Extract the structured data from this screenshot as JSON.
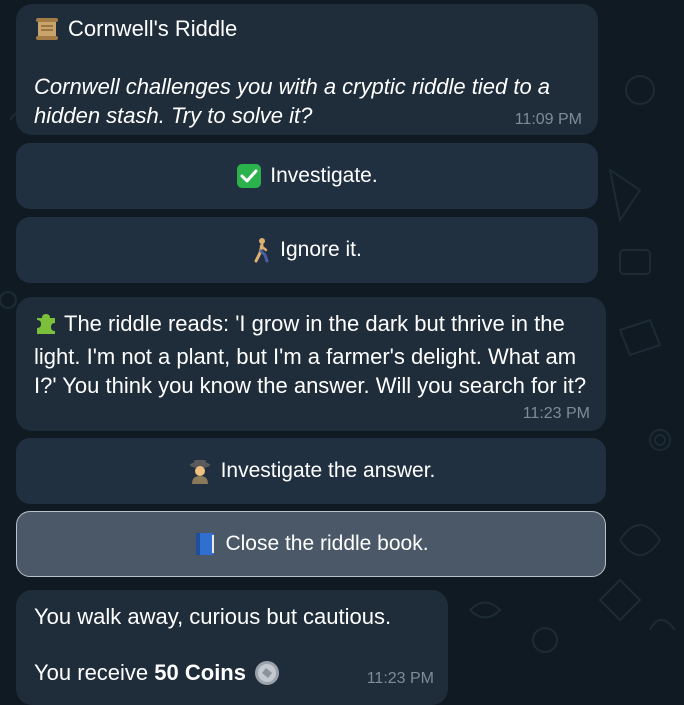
{
  "message1": {
    "title": "Cornwell's Riddle",
    "title_icon": "scroll-icon",
    "body": "Cornwell challenges you with a cryptic riddle tied to a hidden stash. Try to solve it?",
    "time": "11:09 PM"
  },
  "keyboard1": {
    "buttons": [
      {
        "label": "Investigate.",
        "icon": "check-mark-icon"
      },
      {
        "label": "Ignore it.",
        "icon": "walking-person-icon"
      }
    ]
  },
  "message2": {
    "icon": "puzzle-piece-icon",
    "body": "The riddle reads: 'I grow in the dark but thrive in the light. I'm not a plant, but I'm a farmer's delight. What am I?' You think you know the answer. Will you search for it?",
    "time": "11:23 PM"
  },
  "keyboard2": {
    "buttons": [
      {
        "label": "Investigate the answer.",
        "icon": "detective-icon"
      },
      {
        "label": "Close the riddle book.",
        "icon": "blue-book-icon",
        "active": true
      }
    ]
  },
  "message3": {
    "line1": "You walk away, curious but cautious.",
    "line2_prefix": "You receive ",
    "line2_bold": "50 Coins",
    "coin_icon": "coin-icon",
    "time": "11:23 PM"
  },
  "colors": {
    "background": "#0f1a22",
    "bubble": "#1f2c3a",
    "button": "#203040",
    "button_active": "#4a5867",
    "timestamp": "#7f8b97",
    "check_green": "#2bb24c"
  }
}
